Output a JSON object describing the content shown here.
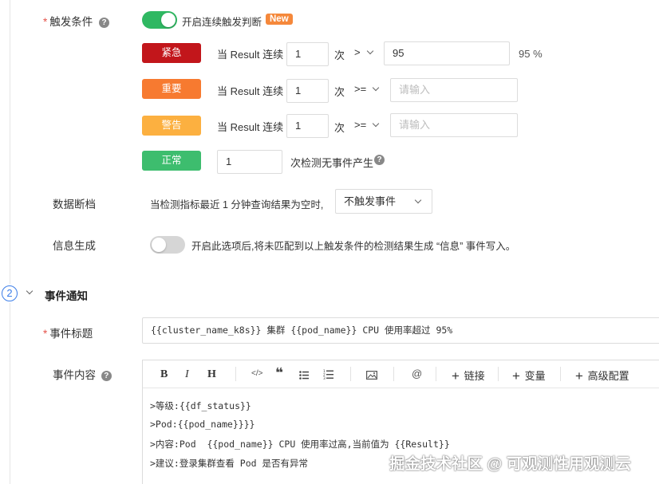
{
  "trigger": {
    "label": "触发条件",
    "continuous_label": "开启连续触发判断",
    "new_badge": "New",
    "rows": [
      {
        "level": "紧急",
        "color": "#c2161b",
        "prefix": "当 Result 连续",
        "count": "1",
        "unit": "次",
        "operator": ">",
        "value": "95",
        "placeholder": "",
        "suffix": "95 %"
      },
      {
        "level": "重要",
        "color": "#f77a30",
        "prefix": "当 Result 连续",
        "count": "1",
        "unit": "次",
        "operator": ">=",
        "value": "",
        "placeholder": "请输入",
        "suffix": ""
      },
      {
        "level": "警告",
        "color": "#fcb040",
        "prefix": "当 Result 连续",
        "count": "1",
        "unit": "次",
        "operator": ">=",
        "value": "",
        "placeholder": "请输入",
        "suffix": ""
      }
    ],
    "normal": {
      "level": "正常",
      "color": "#3dbd6e",
      "count": "1",
      "text": "次检测无事件产生"
    }
  },
  "data_gap": {
    "label": "数据断档",
    "description": "当检测指标最近 1 分钟查询结果为空时,",
    "select_value": "不触发事件"
  },
  "info_gen": {
    "label": "信息生成",
    "description": "开启此选项后,将未匹配到以上触发条件的检测结果生成 “信息” 事件写入。"
  },
  "section2": {
    "number": "2",
    "title": "事件通知"
  },
  "event_title": {
    "label": "事件标题",
    "value": "{{cluster_name_k8s}} 集群 {{pod_name}} CPU 使用率超过 95%"
  },
  "event_content": {
    "label": "事件内容",
    "toolbar": {
      "bold": "B",
      "italic": "I",
      "heading": "H",
      "code": "</>",
      "quote": "❝",
      "link": "链接",
      "variable": "变量",
      "advanced": "高级配置"
    },
    "lines": [
      ">等级:{{df_status}}",
      ">Pod:{{pod_name}}}}",
      ">内容:Pod  {{pod_name}} CPU 使用率过高,当前值为 {{Result}}",
      ">建议:登录集群查看 Pod 是否有异常"
    ]
  },
  "watermark": "掘金技术社区 @ 可观测性用观测云"
}
